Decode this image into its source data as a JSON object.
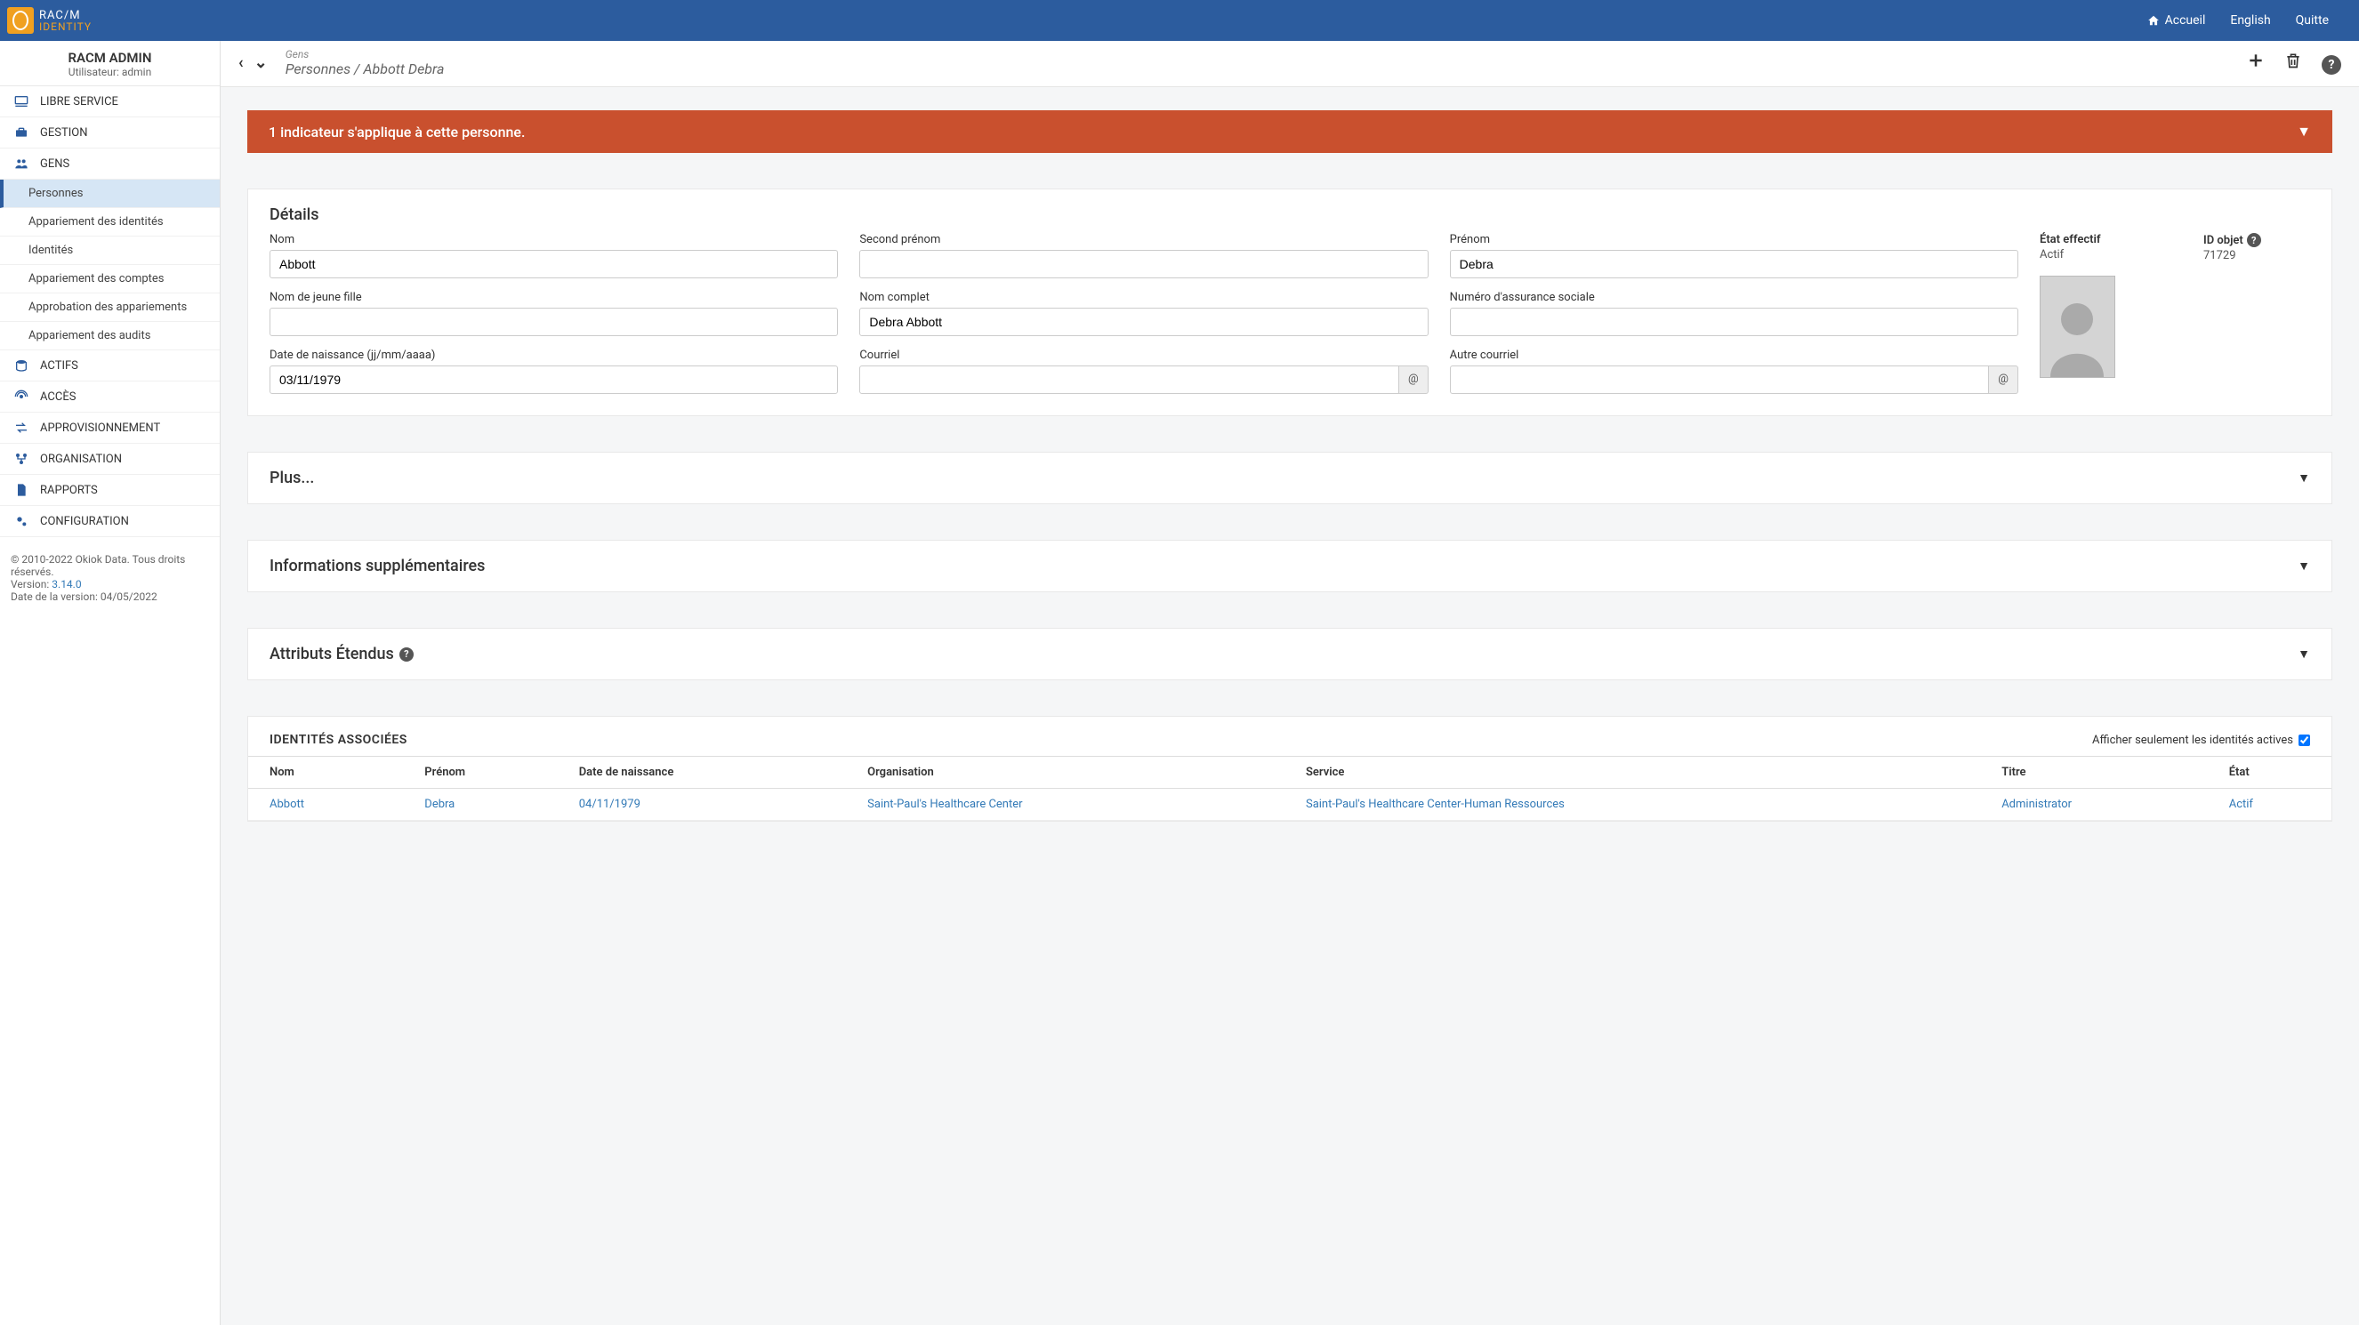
{
  "topbar": {
    "brand_line1": "RAC/M",
    "brand_line2": "IDENTITY",
    "home": "Accueil",
    "lang": "English",
    "quit": "Quitte"
  },
  "sidebar": {
    "admin_title": "RACM ADMIN",
    "user_label": "Utilisateur: admin",
    "items": [
      {
        "label": "LIBRE SERVICE"
      },
      {
        "label": "GESTION"
      },
      {
        "label": "GENS"
      },
      {
        "label": "ACTIFS"
      },
      {
        "label": "ACCÈS"
      },
      {
        "label": "APPROVISIONNEMENT"
      },
      {
        "label": "ORGANISATION"
      },
      {
        "label": "RAPPORTS"
      },
      {
        "label": "CONFIGURATION"
      }
    ],
    "sub_gens": [
      {
        "label": "Personnes"
      },
      {
        "label": "Appariement des identités"
      },
      {
        "label": "Identités"
      },
      {
        "label": "Appariement des comptes"
      },
      {
        "label": "Approbation des appariements"
      },
      {
        "label": "Appariement des audits"
      }
    ],
    "footer": {
      "copyright": "© 2010-2022 Okiok Data. Tous droits réservés.",
      "version_label": "Version: ",
      "version": "3.14.0",
      "release_label": "Date de la version: ",
      "release_date": "04/05/2022"
    }
  },
  "header": {
    "crumb_top": "Gens",
    "crumb_bottom": "Personnes / Abbott Debra"
  },
  "alert": {
    "text": "1 indicateur s'applique à cette personne."
  },
  "details": {
    "title": "Détails",
    "labels": {
      "nom": "Nom",
      "second_prenom": "Second prénom",
      "prenom": "Prénom",
      "nom_jeune_fille": "Nom de jeune fille",
      "nom_complet": "Nom complet",
      "nas": "Numéro d'assurance sociale",
      "dob": "Date de naissance (jj/mm/aaaa)",
      "courriel": "Courriel",
      "autre_courriel": "Autre courriel",
      "etat_effectif": "État effectif",
      "id_objet": "ID objet"
    },
    "values": {
      "nom": "Abbott",
      "second_prenom": "",
      "prenom": "Debra",
      "nom_jeune_fille": "",
      "nom_complet": "Debra Abbott",
      "nas": "",
      "dob": "03/11/1979",
      "courriel": "",
      "autre_courriel": "",
      "etat_effectif": "Actif",
      "id_objet": "71729"
    }
  },
  "panels": {
    "plus": "Plus...",
    "infos": "Informations supplémentaires",
    "attributs": "Attributs Étendus"
  },
  "identities": {
    "title": "IDENTITÉS ASSOCIÉES",
    "filter_label": "Afficher seulement les identités actives",
    "columns": {
      "nom": "Nom",
      "prenom": "Prénom",
      "dob": "Date de naissance",
      "org": "Organisation",
      "service": "Service",
      "titre": "Titre",
      "etat": "État"
    },
    "rows": [
      {
        "nom": "Abbott",
        "prenom": "Debra",
        "dob": "04/11/1979",
        "org": "Saint-Paul's Healthcare Center",
        "service": "Saint-Paul's Healthcare Center-Human Ressources",
        "titre": "Administrator",
        "etat": "Actif"
      }
    ]
  }
}
